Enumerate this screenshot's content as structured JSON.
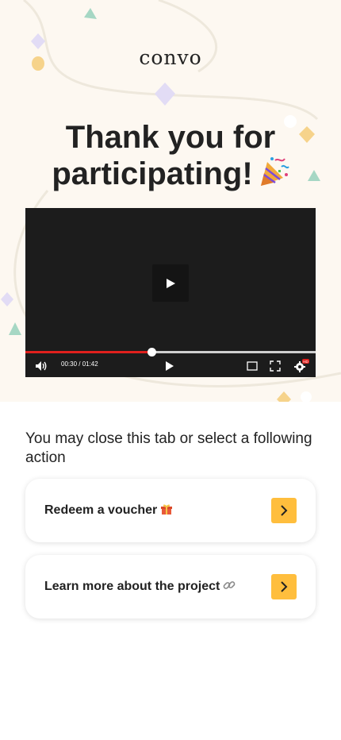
{
  "brand": {
    "logo_text": "convo"
  },
  "hero": {
    "title": "Thank you for participating!",
    "title_emoji": "party-popper"
  },
  "video": {
    "time_display": "00:30 / 01:42",
    "progress_fraction": 0.435,
    "settings_badge": "HD"
  },
  "actions": {
    "prompt": "You may close this tab or select a following action",
    "items": [
      {
        "label": "Redeem a voucher",
        "emoji": "gift-icon"
      },
      {
        "label": "Learn more about the project",
        "emoji": "link-icon"
      }
    ]
  },
  "colors": {
    "background_hero": "#fdf8f1",
    "accent": "#ffbe3d",
    "progress": "#e0201d",
    "text": "#222222"
  }
}
